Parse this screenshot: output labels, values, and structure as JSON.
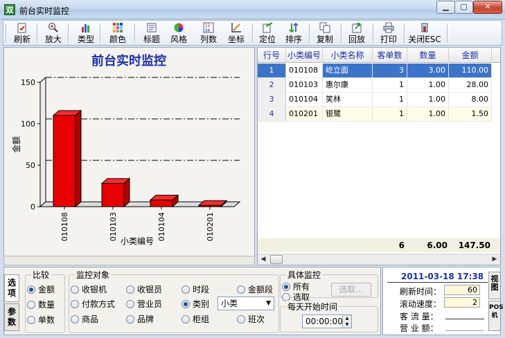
{
  "window": {
    "title": "前台实时监控"
  },
  "toolbar": [
    {
      "label": "刷新",
      "icon": "refresh-icon"
    },
    {
      "label": "放大",
      "icon": "zoom-in-icon"
    },
    {
      "label": "类型",
      "icon": "chart-type-icon"
    },
    {
      "label": "颜色",
      "icon": "color-palette-icon"
    },
    {
      "label": "标题",
      "icon": "title-icon"
    },
    {
      "label": "风格",
      "icon": "style-icon"
    },
    {
      "label": "列数",
      "icon": "columns-icon"
    },
    {
      "label": "坐标",
      "icon": "axis-icon"
    },
    {
      "label": "定位",
      "icon": "locate-icon"
    },
    {
      "label": "排序",
      "icon": "sort-icon"
    },
    {
      "label": "复制",
      "icon": "copy-icon"
    },
    {
      "label": "回放",
      "icon": "playback-icon"
    },
    {
      "label": "打印",
      "icon": "print-icon"
    },
    {
      "label": "关闭ESC",
      "icon": "close-icon"
    }
  ],
  "chart_data": {
    "type": "bar",
    "title": "前台实时监控",
    "xlabel": "小类编号",
    "ylabel": "金额",
    "categories": [
      "010108",
      "010103",
      "010104",
      "010201"
    ],
    "values": [
      110,
      28,
      8,
      1.5
    ],
    "ylim": [
      0,
      150
    ],
    "yticks": [
      0,
      50,
      100,
      150
    ],
    "grid": true,
    "bar_color": "#e60000"
  },
  "grid": {
    "headers": [
      "行号",
      "小类编号",
      "小类名称",
      "客单数",
      "数量",
      "金额"
    ],
    "rows": [
      {
        "no": "1",
        "code": "010108",
        "name": "屹立面",
        "orders": "3",
        "qty": "3.00",
        "amount": "110.00"
      },
      {
        "no": "2",
        "code": "010103",
        "name": "惠尔康",
        "orders": "1",
        "qty": "1.00",
        "amount": "28.00"
      },
      {
        "no": "3",
        "code": "010104",
        "name": "笑林",
        "orders": "1",
        "qty": "1.00",
        "amount": "8.00"
      },
      {
        "no": "4",
        "code": "010201",
        "name": "银鹭",
        "orders": "1",
        "qty": "1.00",
        "amount": "1.50"
      }
    ],
    "totals": {
      "orders": "6",
      "qty": "6.00",
      "amount": "147.50"
    }
  },
  "tabs": {
    "options": "选项",
    "params": "参数"
  },
  "compare": {
    "title": "比较",
    "options": [
      "金额",
      "数量",
      "单数"
    ],
    "selected": "金额"
  },
  "monitor": {
    "title": "监控对象",
    "options": [
      "收银机",
      "收银员",
      "时段",
      "金额段",
      "付款方式",
      "营业员",
      "类别",
      "商品",
      "品牌",
      "柜组",
      "班次"
    ],
    "selected": "类别",
    "category_select": "小类"
  },
  "specific": {
    "title": "具体监控",
    "options": [
      "所有",
      "选取"
    ],
    "selected": "所有",
    "pick_button": "选取...",
    "daily_start_label": "每天开始时间",
    "daily_start_value": "00:00:00"
  },
  "status": {
    "datetime": "2011-03-18 17:38",
    "refresh_label": "刷新时间：",
    "refresh_value": "60",
    "scroll_label": "滚动速度：",
    "scroll_value": "2",
    "traffic_label": "客 流 量：",
    "sales_label": "营 业 额：",
    "side_tabs": [
      "视图",
      "POS机"
    ]
  }
}
